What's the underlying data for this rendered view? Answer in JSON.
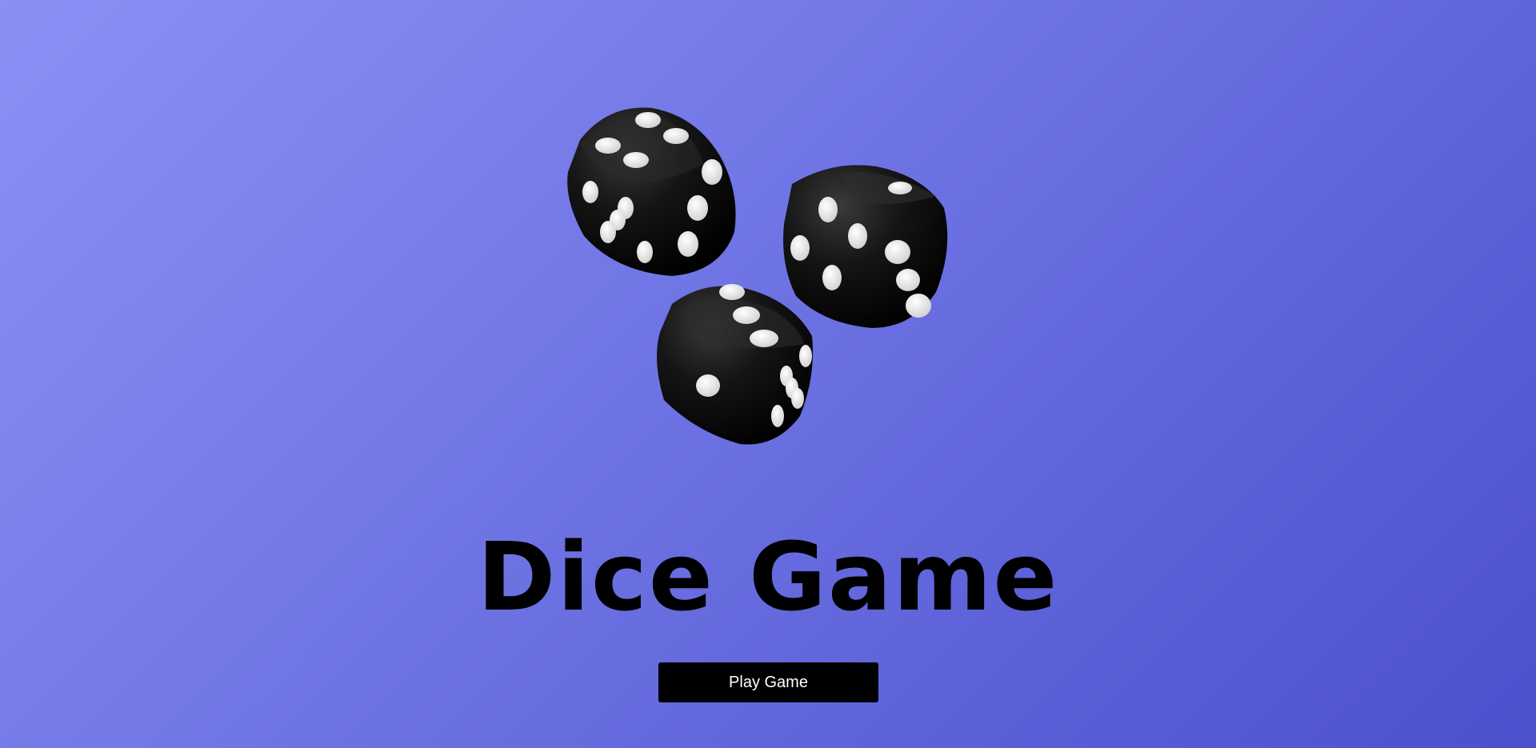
{
  "title": "Dice Game",
  "play_button_label": "Play Game",
  "colors": {
    "background_gradient": [
      "#8b8ff5",
      "#4d50cc"
    ],
    "title": "#000000",
    "button_bg": "#000000",
    "button_text": "#ffffff",
    "die_body": "#111111",
    "die_pip": "#f2f2f2"
  },
  "dice": [
    {
      "name": "top-left-die",
      "faces_visible": [
        4,
        3,
        5
      ]
    },
    {
      "name": "right-die",
      "faces_visible": [
        4,
        3,
        1
      ]
    },
    {
      "name": "bottom-die",
      "faces_visible": [
        3,
        1,
        5
      ]
    }
  ]
}
